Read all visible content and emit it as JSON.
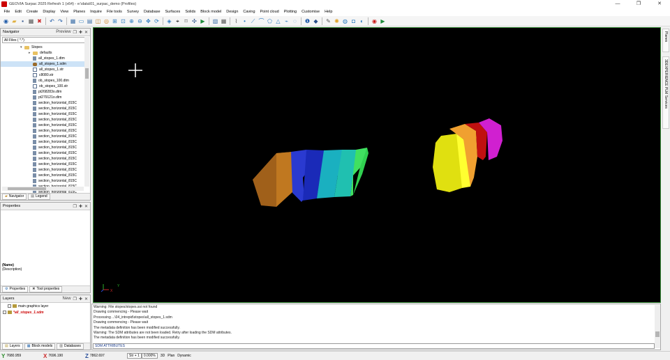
{
  "window": {
    "title": "GEOVIA Surpac 2025 Refresh 1 (x64) - e:\\data\\01_surpac_demo (Profiles)",
    "controls": [
      "—",
      "❐",
      "✕"
    ]
  },
  "menu": [
    "File",
    "Edit",
    "Create",
    "Display",
    "View",
    "Planes",
    "Inquire",
    "File tools",
    "Survey",
    "Database",
    "Surfaces",
    "Solids",
    "Block model",
    "Design",
    "Caving",
    "Point cloud",
    "Plotting",
    "Customise",
    "Help"
  ],
  "toolbar": {
    "icons": [
      {
        "name": "globe-icon",
        "glyph": "◉",
        "color": "#1e5aa8"
      },
      {
        "name": "open-folder-icon",
        "glyph": "▰",
        "color": "#e0b040"
      },
      {
        "name": "save-icon",
        "glyph": "▪",
        "color": "#2a4f8a"
      },
      {
        "name": "print-icon",
        "glyph": "▦",
        "color": "#555555"
      },
      {
        "name": "erase-icon",
        "glyph": "✖",
        "color": "#cc2a2a"
      },
      {
        "name": "sep"
      },
      {
        "name": "undo-icon",
        "glyph": "↶",
        "color": "#1e5aa8"
      },
      {
        "name": "redo-icon",
        "glyph": "↷",
        "color": "#1e5aa8"
      },
      {
        "name": "sep"
      },
      {
        "name": "grid-view-icon",
        "glyph": "▦",
        "color": "#3a6ea8"
      },
      {
        "name": "screen-icon",
        "glyph": "▭",
        "color": "#2a7ac0"
      },
      {
        "name": "layers-icon",
        "glyph": "▤",
        "color": "#3a6ea8"
      },
      {
        "name": "box-icon",
        "glyph": "◫",
        "color": "#c07a20"
      },
      {
        "name": "target-icon",
        "glyph": "◎",
        "color": "#d08020"
      },
      {
        "name": "zoom-window-icon",
        "glyph": "⊞",
        "color": "#2a7ac0"
      },
      {
        "name": "zoom-all-icon",
        "glyph": "⊡",
        "color": "#2a7ac0"
      },
      {
        "name": "zoom-in-icon",
        "glyph": "⊕",
        "color": "#2a7ac0"
      },
      {
        "name": "zoom-out-icon",
        "glyph": "⊖",
        "color": "#2a7ac0"
      },
      {
        "name": "pan-icon",
        "glyph": "✥",
        "color": "#2a7ac0"
      },
      {
        "name": "rotate-icon",
        "glyph": "⟳",
        "color": "#2a7ac0"
      },
      {
        "name": "sep"
      },
      {
        "name": "compass-icon",
        "glyph": "◈",
        "color": "#2a7ac0"
      },
      {
        "name": "select-tool-icon",
        "glyph": "⌖",
        "color": "#000000"
      },
      {
        "name": "snap-icon",
        "glyph": "⌑",
        "color": "#555555"
      },
      {
        "name": "move-icon",
        "glyph": "✣",
        "color": "#2a4f8a"
      },
      {
        "name": "run-icon",
        "glyph": "▶",
        "color": "#1e8a3a"
      },
      {
        "name": "sep"
      },
      {
        "name": "new-layer-icon",
        "glyph": "▧",
        "color": "#3a6ea8"
      },
      {
        "name": "table-icon",
        "glyph": "▦",
        "color": "#555555"
      },
      {
        "name": "sep"
      },
      {
        "name": "digitise-icon",
        "glyph": "⌇",
        "color": "#555555"
      },
      {
        "name": "point-icon",
        "glyph": "•",
        "color": "#2a7ac0"
      },
      {
        "name": "line-icon",
        "glyph": "⟋",
        "color": "#2a7ac0"
      },
      {
        "name": "segment-icon",
        "glyph": "⌒",
        "color": "#2a7ac0"
      },
      {
        "name": "polygon-icon",
        "glyph": "⬠",
        "color": "#2a7ac0"
      },
      {
        "name": "triangle-icon",
        "glyph": "△",
        "color": "#2a7ac0"
      },
      {
        "name": "string-icon",
        "glyph": "⌁",
        "color": "#2a7ac0"
      },
      {
        "name": "close-string-icon",
        "glyph": "◌",
        "color": "#2a7ac0"
      },
      {
        "name": "sep"
      },
      {
        "name": "info-icon",
        "glyph": "❶",
        "color": "#1e5aa8"
      },
      {
        "name": "properties-icon",
        "glyph": "◆",
        "color": "#2a4f8a"
      },
      {
        "name": "sep"
      },
      {
        "name": "pen-icon",
        "glyph": "✎",
        "color": "#555555"
      },
      {
        "name": "light-icon",
        "glyph": "✺",
        "color": "#e0a020"
      },
      {
        "name": "sphere-icon",
        "glyph": "◍",
        "color": "#2a7ac0"
      },
      {
        "name": "cube-icon",
        "glyph": "◘",
        "color": "#2a7ac0"
      },
      {
        "name": "shade-icon",
        "glyph": "◐",
        "color": "#2a7ac0"
      },
      {
        "name": "sep"
      },
      {
        "name": "stop-icon",
        "glyph": "◉",
        "color": "#cc1a1a"
      },
      {
        "name": "play-icon",
        "glyph": "▶",
        "color": "#1e8a3a"
      }
    ]
  },
  "navigator": {
    "title": "Navigator",
    "preview_label": "Preview",
    "filter": "All Files ( *.*)",
    "tree": [
      {
        "label": "Stopes",
        "type": "folder",
        "indent": 1,
        "expander": "▾"
      },
      {
        "label": "defaults",
        "type": "folder",
        "indent": 2,
        "expander": "▸"
      },
      {
        "label": "all_stopes_1.dtm",
        "type": "file",
        "indent": 2
      },
      {
        "label": "all_stopes_1.sdm",
        "type": "sdm",
        "indent": 2,
        "selected": true
      },
      {
        "label": "all_stopes_1.str",
        "type": "str",
        "indent": 2
      },
      {
        "label": "c8080.str",
        "type": "str",
        "indent": 2
      },
      {
        "label": "ob_stopes_100.dtm",
        "type": "file",
        "indent": 2
      },
      {
        "label": "ob_stopes_100.str",
        "type": "str",
        "indent": 2
      },
      {
        "label": "pt268283o.dtm",
        "type": "file",
        "indent": 2
      },
      {
        "label": "pt279121o.dtm",
        "type": "file",
        "indent": 2
      },
      {
        "label": "section_horizontal_815C",
        "type": "file",
        "indent": 2
      },
      {
        "label": "section_horizontal_815C",
        "type": "file",
        "indent": 2
      },
      {
        "label": "section_horizontal_815C",
        "type": "file",
        "indent": 2
      },
      {
        "label": "section_horizontal_815C",
        "type": "file",
        "indent": 2
      },
      {
        "label": "section_horizontal_815C",
        "type": "file",
        "indent": 2
      },
      {
        "label": "section_horizontal_815C",
        "type": "file",
        "indent": 2
      },
      {
        "label": "section_horizontal_815C",
        "type": "file",
        "indent": 2
      },
      {
        "label": "section_horizontal_815C",
        "type": "file",
        "indent": 2
      },
      {
        "label": "section_horizontal_815C",
        "type": "file",
        "indent": 2
      },
      {
        "label": "section_horizontal_815C",
        "type": "file",
        "indent": 2
      },
      {
        "label": "section_horizontal_815C",
        "type": "file",
        "indent": 2
      },
      {
        "label": "section_horizontal_815C",
        "type": "file",
        "indent": 2
      },
      {
        "label": "section_horizontal_815C",
        "type": "file",
        "indent": 2
      },
      {
        "label": "section_horizontal_815C",
        "type": "file",
        "indent": 2
      },
      {
        "label": "section_horizontal_815C",
        "type": "file",
        "indent": 2
      },
      {
        "label": "section_horizontal_815C",
        "type": "file",
        "indent": 2
      },
      {
        "label": "section_horizontal_815C",
        "type": "file",
        "indent": 2
      }
    ],
    "tabs": [
      "Navigator",
      "Legend"
    ]
  },
  "properties": {
    "title": "Properties",
    "name_label": "(Name)",
    "description_label": "(Description)",
    "tabs": [
      "Properties",
      "Tool properties"
    ]
  },
  "layers": {
    "title": "Layers",
    "new_label": "New",
    "items": [
      {
        "label": "main graphics layer",
        "active": false
      },
      {
        "label": "*all_stopes_1.sdm",
        "active": true
      }
    ],
    "tabs": [
      "Layers",
      "Block models",
      "Databases"
    ]
  },
  "console": {
    "lines": [
      "Warning: File stopes/stopes.ssi not found",
      "Drawing commencing - Please wait",
      "Processing ...\\04_intrepid\\stopes\\all_stopes_1.sdm",
      "Drawing commencing - Please wait",
      "The metadata definition has been modified successfully.",
      "Warning: The SDM attributes are not been loaded. Retry after loading the SDM attributes.",
      "The metadata definition has been modified successfully."
    ],
    "command": "SDM ATTRIBUTES"
  },
  "right_rail": {
    "tabs": [
      "Planes",
      "3DEXPERIENCE PLM Services"
    ]
  },
  "statusbar": {
    "y": {
      "axis": "Y",
      "value": "7680.959",
      "color": "#2a8a2a"
    },
    "x": {
      "axis": "X",
      "value": "7696.190",
      "color": "#cc2a2a"
    },
    "z": {
      "axis": "Z",
      "value": "7862.697",
      "color": "#2a4f9a"
    },
    "str_label": "Str + 1",
    "zoom": "0.000%",
    "mode_3d": "3D",
    "view": "Plan",
    "render": "Dynamic"
  },
  "viewport": {
    "background": "#000000",
    "border_color": "#3a8c3a",
    "stope_colors": [
      "#a0601a",
      "#c07820",
      "#2a3ad0",
      "#1a2ab8",
      "#1ab0c0",
      "#20c0b0",
      "#40e060",
      "#30d050",
      "#e0e010",
      "#ffff30",
      "#f0a030",
      "#c01010",
      "#d020d0"
    ],
    "axis_labels": {
      "y": "Y",
      "x": "X"
    }
  }
}
